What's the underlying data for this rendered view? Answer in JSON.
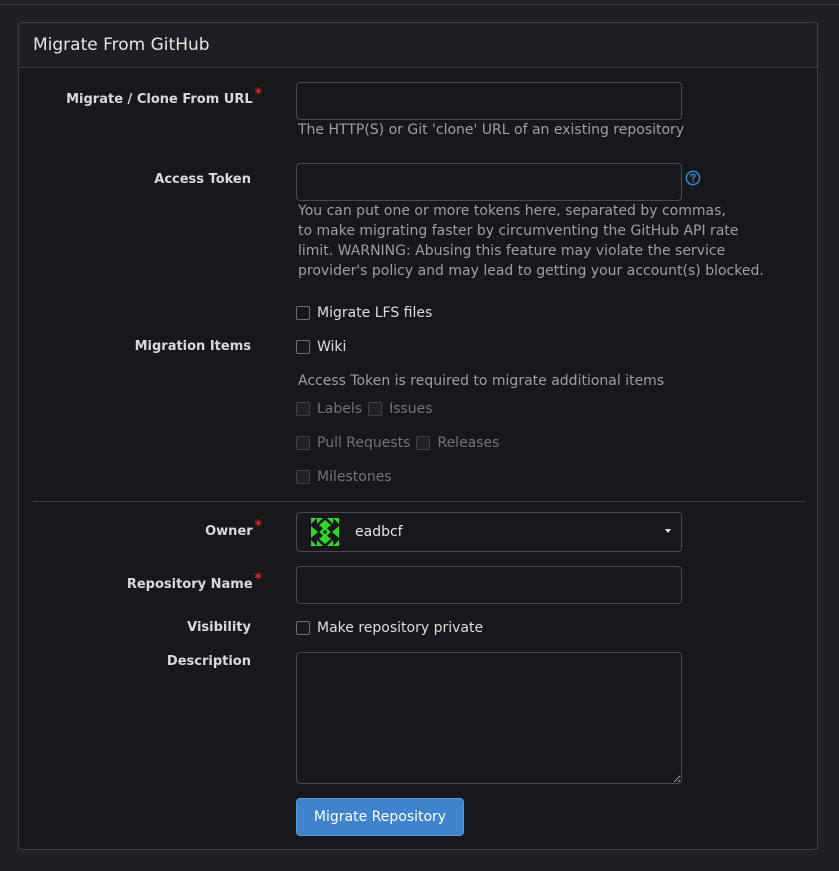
{
  "panel": {
    "title": "Migrate From GitHub"
  },
  "form": {
    "clone_url": {
      "label": "Migrate / Clone From URL",
      "required_mark": "*",
      "value": "",
      "help": "The HTTP(S) or Git 'clone' URL of an existing repository"
    },
    "access_token": {
      "label": "Access Token",
      "value": "",
      "help_lines": [
        "You can put one or more tokens here, separated by commas,",
        "to make migrating faster by circumventing the GitHub API rate",
        "limit. WARNING: Abusing this feature may violate the service",
        "provider's policy and may lead to getting your account(s) blocked."
      ],
      "help_icon": "question-circle-icon"
    },
    "lfs": {
      "label": "Migrate LFS files",
      "checked": false
    },
    "migration_items": {
      "label": "Migration Items",
      "wiki": {
        "label": "Wiki",
        "checked": false
      },
      "note": "Access Token is required to migrate additional items",
      "labels": "Labels",
      "issues": "Issues",
      "pull_requests": "Pull Requests",
      "releases": "Releases",
      "milestones": "Milestones"
    },
    "owner": {
      "label": "Owner",
      "required_mark": "*",
      "value": "eadbcf",
      "avatar_color": "#32d52c"
    },
    "repo_name": {
      "label": "Repository Name",
      "required_mark": "*",
      "value": ""
    },
    "visibility": {
      "label": "Visibility",
      "option": "Make repository private",
      "checked": false
    },
    "description": {
      "label": "Description",
      "value": ""
    },
    "submit": {
      "label": "Migrate Repository"
    }
  },
  "colors": {
    "background": "#1e2023",
    "panel": "#16181b",
    "primary_button": "#3d84cc",
    "required": "#db2828",
    "help_icon": "#3d84cc"
  }
}
